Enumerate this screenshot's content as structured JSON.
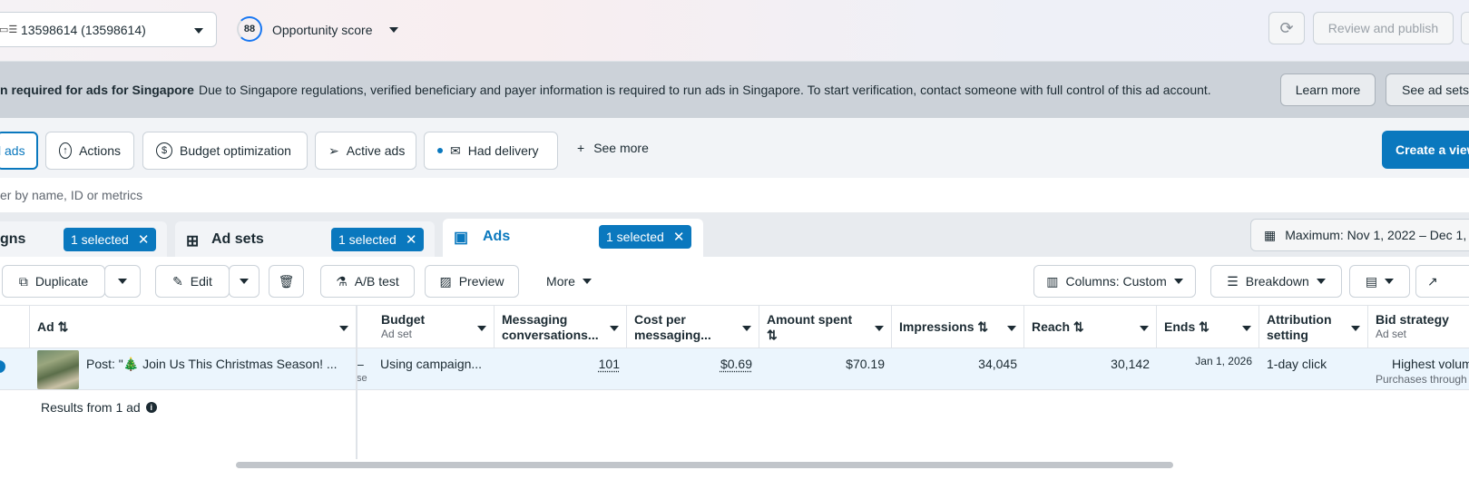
{
  "header": {
    "account": "13598614 (13598614)",
    "score_value": "88",
    "score_label": "Opportunity score",
    "review_label": "Review and publish"
  },
  "banner": {
    "title": "n required for ads for Singapore",
    "message": "Due to Singapore regulations, verified beneficiary and payer information is required to run ads in Singapore. To start verification, contact someone with full control of this ad account.",
    "learn_more": "Learn more",
    "see_ad_sets": "See ad sets"
  },
  "filters": {
    "all_ads": "l ads",
    "actions": "Actions",
    "budget_optimization": "Budget optimization",
    "active_ads": "Active ads",
    "had_delivery": "Had delivery",
    "see_more": "See more",
    "create_view": "Create a view"
  },
  "search": {
    "placeholder": "er by name, ID or metrics"
  },
  "levels": {
    "campaigns": "gns",
    "campaigns_selected": "1 selected",
    "ad_sets": "Ad sets",
    "ad_sets_selected": "1 selected",
    "ads": "Ads",
    "ads_selected": "1 selected",
    "date_range": "Maximum: Nov 1, 2022 – Dec 1, 2"
  },
  "toolbar": {
    "duplicate": "Duplicate",
    "edit": "Edit",
    "ab_test": "A/B test",
    "preview": "Preview",
    "more": "More",
    "columns": "Columns: Custom",
    "breakdown": "Breakdown"
  },
  "table": {
    "columns": {
      "ad": "Ad",
      "budget": "Budget",
      "budget_sub": "Ad set",
      "messaging": "Messaging conversations...",
      "cost_per": "Cost per messaging...",
      "amount_spent": "Amount spent",
      "impressions": "Impressions",
      "reach": "Reach",
      "ends": "Ends",
      "attribution": "Attribution setting",
      "bid_strategy": "Bid strategy",
      "bid_sub": "Ad set"
    },
    "row": {
      "ad_name": "Post: \"🎄 Join Us This Christmas Season! ...",
      "dash": "–",
      "budget_partial": "se",
      "budget": "Using campaign...",
      "messaging": "101",
      "cost_per": "$0.69",
      "amount_spent": "$70.19",
      "impressions": "34,045",
      "reach": "30,142",
      "ends": "Jan 1, 2026",
      "attribution": "1-day click",
      "bid_strategy": "Highest volum",
      "bid_sub": "Purchases through"
    },
    "results": "Results from 1 ad"
  },
  "colors": {
    "accent": "#0a78be",
    "banner": "#ccd2d9",
    "selected_row": "#ebf5fd"
  }
}
